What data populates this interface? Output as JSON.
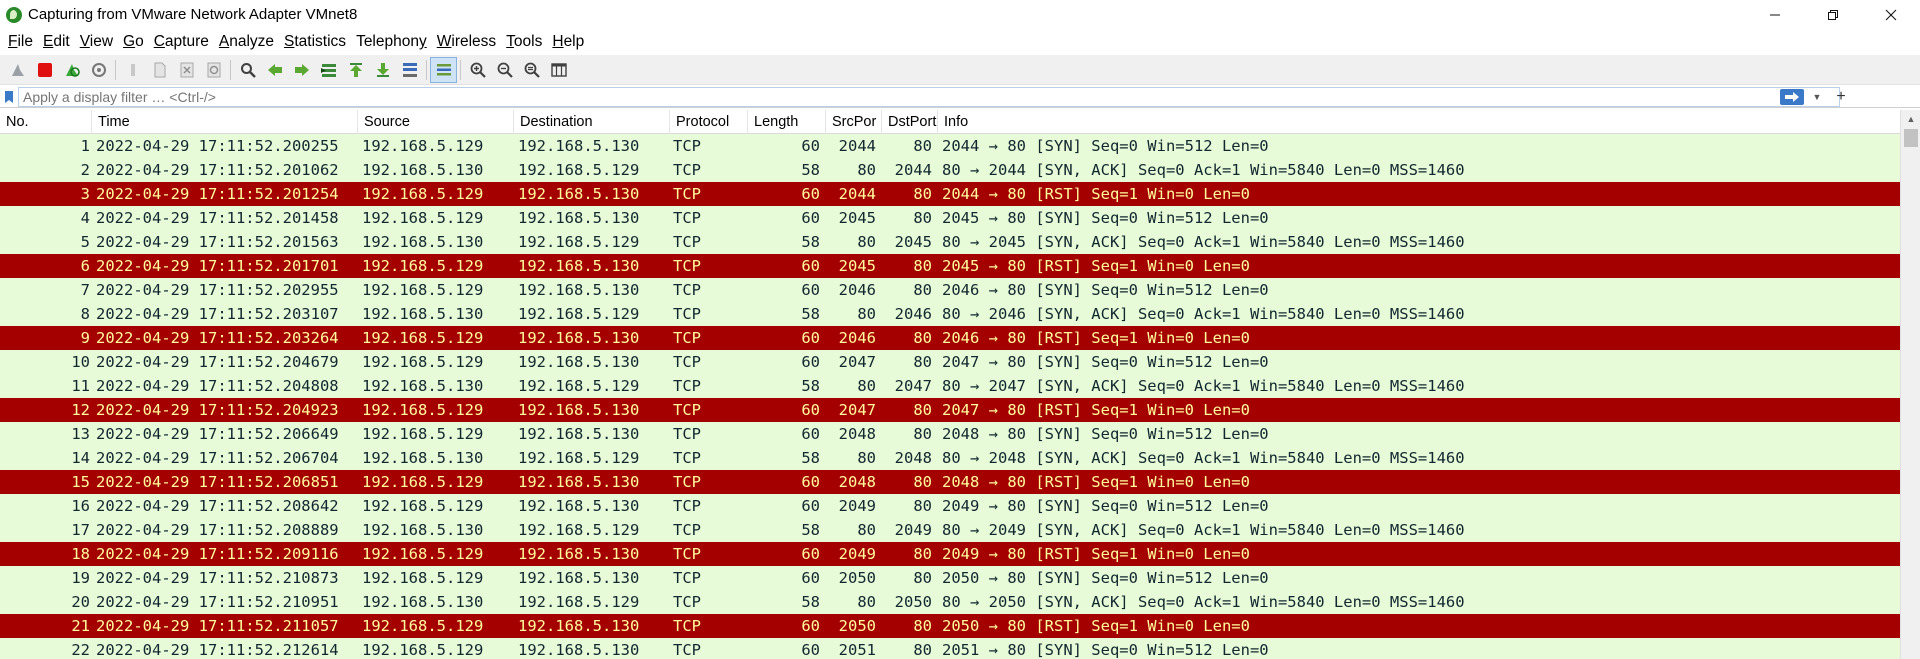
{
  "window": {
    "title": "Capturing from VMware Network Adapter VMnet8",
    "minimize_glyph": "—",
    "close_glyph": "✕"
  },
  "menu": [
    {
      "prefix": "",
      "ul": "F",
      "rest": "ile"
    },
    {
      "prefix": "",
      "ul": "E",
      "rest": "dit"
    },
    {
      "prefix": "",
      "ul": "V",
      "rest": "iew"
    },
    {
      "prefix": "",
      "ul": "G",
      "rest": "o"
    },
    {
      "prefix": "",
      "ul": "C",
      "rest": "apture"
    },
    {
      "prefix": "",
      "ul": "A",
      "rest": "nalyze"
    },
    {
      "prefix": "",
      "ul": "S",
      "rest": "tatistics"
    },
    {
      "prefix": "Telephon",
      "ul": "y",
      "rest": ""
    },
    {
      "prefix": "",
      "ul": "W",
      "rest": "ireless"
    },
    {
      "prefix": "",
      "ul": "T",
      "rest": "ools"
    },
    {
      "prefix": "",
      "ul": "H",
      "rest": "elp"
    }
  ],
  "filter": {
    "placeholder": "Apply a display filter … <Ctrl-/>",
    "add_label": "+"
  },
  "columns": [
    "No.",
    "Time",
    "Source",
    "Destination",
    "Protocol",
    "Length",
    "SrcPor",
    "DstPort",
    "Info"
  ],
  "packets": [
    {
      "no": "1",
      "time": "2022-04-29 17:11:52.200255",
      "src": "192.168.5.129",
      "dst": "192.168.5.130",
      "proto": "TCP",
      "len": "60",
      "sport": "2044",
      "dport": "80",
      "info": "2044 → 80 [SYN] Seq=0 Win=512 Len=0",
      "style": "normal"
    },
    {
      "no": "2",
      "time": "2022-04-29 17:11:52.201062",
      "src": "192.168.5.130",
      "dst": "192.168.5.129",
      "proto": "TCP",
      "len": "58",
      "sport": "80",
      "dport": "2044",
      "info": "80 → 2044 [SYN, ACK] Seq=0 Ack=1 Win=5840 Len=0 MSS=1460",
      "style": "normal"
    },
    {
      "no": "3",
      "time": "2022-04-29 17:11:52.201254",
      "src": "192.168.5.129",
      "dst": "192.168.5.130",
      "proto": "TCP",
      "len": "60",
      "sport": "2044",
      "dport": "80",
      "info": "2044 → 80 [RST] Seq=1 Win=0 Len=0",
      "style": "rst"
    },
    {
      "no": "4",
      "time": "2022-04-29 17:11:52.201458",
      "src": "192.168.5.129",
      "dst": "192.168.5.130",
      "proto": "TCP",
      "len": "60",
      "sport": "2045",
      "dport": "80",
      "info": "2045 → 80 [SYN] Seq=0 Win=512 Len=0",
      "style": "normal"
    },
    {
      "no": "5",
      "time": "2022-04-29 17:11:52.201563",
      "src": "192.168.5.130",
      "dst": "192.168.5.129",
      "proto": "TCP",
      "len": "58",
      "sport": "80",
      "dport": "2045",
      "info": "80 → 2045 [SYN, ACK] Seq=0 Ack=1 Win=5840 Len=0 MSS=1460",
      "style": "normal"
    },
    {
      "no": "6",
      "time": "2022-04-29 17:11:52.201701",
      "src": "192.168.5.129",
      "dst": "192.168.5.130",
      "proto": "TCP",
      "len": "60",
      "sport": "2045",
      "dport": "80",
      "info": "2045 → 80 [RST] Seq=1 Win=0 Len=0",
      "style": "rst"
    },
    {
      "no": "7",
      "time": "2022-04-29 17:11:52.202955",
      "src": "192.168.5.129",
      "dst": "192.168.5.130",
      "proto": "TCP",
      "len": "60",
      "sport": "2046",
      "dport": "80",
      "info": "2046 → 80 [SYN] Seq=0 Win=512 Len=0",
      "style": "normal"
    },
    {
      "no": "8",
      "time": "2022-04-29 17:11:52.203107",
      "src": "192.168.5.130",
      "dst": "192.168.5.129",
      "proto": "TCP",
      "len": "58",
      "sport": "80",
      "dport": "2046",
      "info": "80 → 2046 [SYN, ACK] Seq=0 Ack=1 Win=5840 Len=0 MSS=1460",
      "style": "normal"
    },
    {
      "no": "9",
      "time": "2022-04-29 17:11:52.203264",
      "src": "192.168.5.129",
      "dst": "192.168.5.130",
      "proto": "TCP",
      "len": "60",
      "sport": "2046",
      "dport": "80",
      "info": "2046 → 80 [RST] Seq=1 Win=0 Len=0",
      "style": "rst"
    },
    {
      "no": "10",
      "time": "2022-04-29 17:11:52.204679",
      "src": "192.168.5.129",
      "dst": "192.168.5.130",
      "proto": "TCP",
      "len": "60",
      "sport": "2047",
      "dport": "80",
      "info": "2047 → 80 [SYN] Seq=0 Win=512 Len=0",
      "style": "normal"
    },
    {
      "no": "11",
      "time": "2022-04-29 17:11:52.204808",
      "src": "192.168.5.130",
      "dst": "192.168.5.129",
      "proto": "TCP",
      "len": "58",
      "sport": "80",
      "dport": "2047",
      "info": "80 → 2047 [SYN, ACK] Seq=0 Ack=1 Win=5840 Len=0 MSS=1460",
      "style": "normal"
    },
    {
      "no": "12",
      "time": "2022-04-29 17:11:52.204923",
      "src": "192.168.5.129",
      "dst": "192.168.5.130",
      "proto": "TCP",
      "len": "60",
      "sport": "2047",
      "dport": "80",
      "info": "2047 → 80 [RST] Seq=1 Win=0 Len=0",
      "style": "rst"
    },
    {
      "no": "13",
      "time": "2022-04-29 17:11:52.206649",
      "src": "192.168.5.129",
      "dst": "192.168.5.130",
      "proto": "TCP",
      "len": "60",
      "sport": "2048",
      "dport": "80",
      "info": "2048 → 80 [SYN] Seq=0 Win=512 Len=0",
      "style": "normal"
    },
    {
      "no": "14",
      "time": "2022-04-29 17:11:52.206704",
      "src": "192.168.5.130",
      "dst": "192.168.5.129",
      "proto": "TCP",
      "len": "58",
      "sport": "80",
      "dport": "2048",
      "info": "80 → 2048 [SYN, ACK] Seq=0 Ack=1 Win=5840 Len=0 MSS=1460",
      "style": "normal"
    },
    {
      "no": "15",
      "time": "2022-04-29 17:11:52.206851",
      "src": "192.168.5.129",
      "dst": "192.168.5.130",
      "proto": "TCP",
      "len": "60",
      "sport": "2048",
      "dport": "80",
      "info": "2048 → 80 [RST] Seq=1 Win=0 Len=0",
      "style": "rst"
    },
    {
      "no": "16",
      "time": "2022-04-29 17:11:52.208642",
      "src": "192.168.5.129",
      "dst": "192.168.5.130",
      "proto": "TCP",
      "len": "60",
      "sport": "2049",
      "dport": "80",
      "info": "2049 → 80 [SYN] Seq=0 Win=512 Len=0",
      "style": "normal"
    },
    {
      "no": "17",
      "time": "2022-04-29 17:11:52.208889",
      "src": "192.168.5.130",
      "dst": "192.168.5.129",
      "proto": "TCP",
      "len": "58",
      "sport": "80",
      "dport": "2049",
      "info": "80 → 2049 [SYN, ACK] Seq=0 Ack=1 Win=5840 Len=0 MSS=1460",
      "style": "normal"
    },
    {
      "no": "18",
      "time": "2022-04-29 17:11:52.209116",
      "src": "192.168.5.129",
      "dst": "192.168.5.130",
      "proto": "TCP",
      "len": "60",
      "sport": "2049",
      "dport": "80",
      "info": "2049 → 80 [RST] Seq=1 Win=0 Len=0",
      "style": "rst"
    },
    {
      "no": "19",
      "time": "2022-04-29 17:11:52.210873",
      "src": "192.168.5.129",
      "dst": "192.168.5.130",
      "proto": "TCP",
      "len": "60",
      "sport": "2050",
      "dport": "80",
      "info": "2050 → 80 [SYN] Seq=0 Win=512 Len=0",
      "style": "normal"
    },
    {
      "no": "20",
      "time": "2022-04-29 17:11:52.210951",
      "src": "192.168.5.130",
      "dst": "192.168.5.129",
      "proto": "TCP",
      "len": "58",
      "sport": "80",
      "dport": "2050",
      "info": "80 → 2050 [SYN, ACK] Seq=0 Ack=1 Win=5840 Len=0 MSS=1460",
      "style": "normal"
    },
    {
      "no": "21",
      "time": "2022-04-29 17:11:52.211057",
      "src": "192.168.5.129",
      "dst": "192.168.5.130",
      "proto": "TCP",
      "len": "60",
      "sport": "2050",
      "dport": "80",
      "info": "2050 → 80 [RST] Seq=1 Win=0 Len=0",
      "style": "rst"
    },
    {
      "no": "22",
      "time": "2022-04-29 17:11:52.212614",
      "src": "192.168.5.129",
      "dst": "192.168.5.130",
      "proto": "TCP",
      "len": "60",
      "sport": "2051",
      "dport": "80",
      "info": "2051 → 80 [SYN] Seq=0 Win=512 Len=0",
      "style": "normal"
    }
  ],
  "colors": {
    "row_normal_bg": "#e7fbd9",
    "row_normal_fg": "#12272e",
    "row_rst_bg": "#a40000",
    "row_rst_fg": "#fffc9c"
  },
  "icons": {
    "toolbar": [
      "shark-fin-start-icon",
      "stop-capture-icon",
      "restart-capture-icon",
      "capture-options-icon",
      "open-file-icon",
      "save-file-icon",
      "close-file-icon",
      "reload-file-icon",
      "find-packet-icon",
      "go-back-icon",
      "go-forward-icon",
      "go-to-packet-icon",
      "first-packet-icon",
      "last-packet-icon",
      "auto-scroll-icon",
      "colorize-icon",
      "zoom-in-icon",
      "zoom-out-icon",
      "normal-size-icon",
      "resize-columns-icon"
    ]
  }
}
